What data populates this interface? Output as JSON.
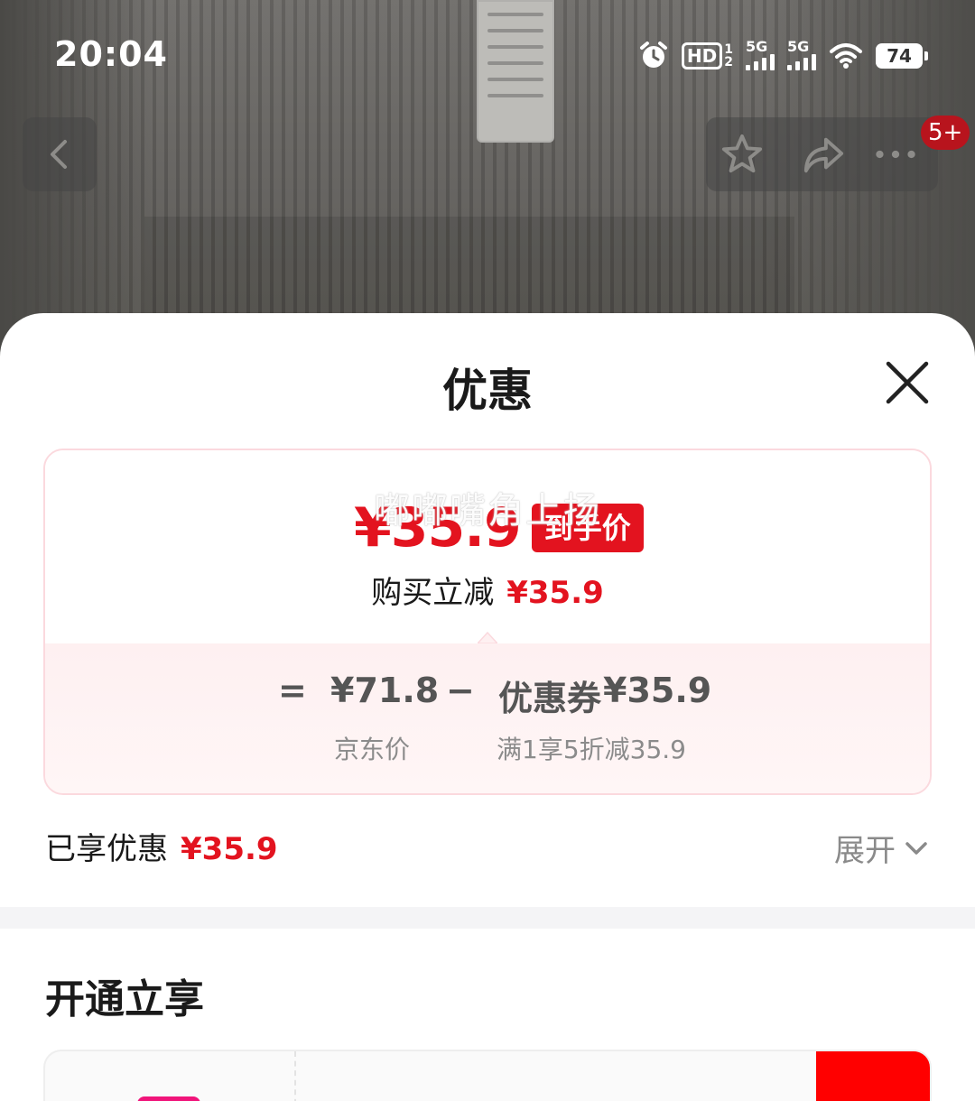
{
  "status_bar": {
    "time": "20:04",
    "icons": [
      "alarm-icon",
      "hd-icon",
      "signal-5g-icon",
      "signal-5g-icon",
      "wifi-icon",
      "battery-icon"
    ],
    "hd_label": "HD",
    "sim1_label": "1",
    "sim2_label": "2",
    "net1_label": "5G",
    "net2_label": "5G",
    "battery_level": "74"
  },
  "nav": {
    "back_icon": "chevron-left-icon",
    "favorite_icon": "star-icon",
    "share_icon": "share-icon",
    "more_icon": "more-icon",
    "message_badge": "5+"
  },
  "sheet": {
    "title": "优惠",
    "close_icon": "close-icon",
    "promo": {
      "watermark": "嘟嘟嘴角上扬",
      "final_price": "¥35.9",
      "final_price_tag": "到手价",
      "reduce_label": "购买立减",
      "reduce_amount": "¥35.9",
      "equals": "=",
      "jd_price": "¥71.8",
      "minus": "−",
      "coupon_label": "优惠券",
      "coupon_amount": "¥35.9",
      "jd_price_caption": "京东价",
      "coupon_caption": "满1享5折减35.9"
    },
    "enjoyed_label": "已享优惠",
    "enjoyed_amount": "¥35.9",
    "expand_label": "展开",
    "section_title": "开通立享"
  },
  "colors": {
    "accent_red": "#e3131f",
    "badge_red": "#b8141d",
    "card_border": "#fbd9de",
    "card_bottom_bg": "#fef0f1",
    "member_logo": "#f0147a"
  }
}
